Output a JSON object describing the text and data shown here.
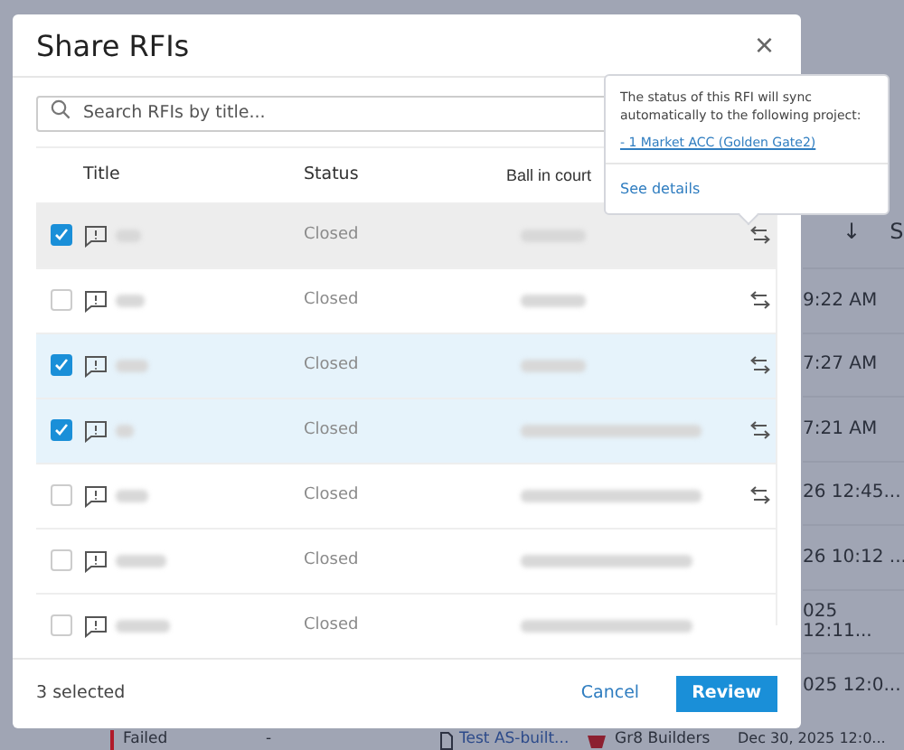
{
  "background": {
    "sort_arrow": "↓",
    "column_cut": "S",
    "times": [
      "9:22 AM",
      "7:27 AM",
      "7:21 AM",
      "26 12:45...",
      "26 10:12 ...",
      "025 12:11...",
      "025 12:0..."
    ],
    "last_row": {
      "status": "Failed",
      "dash": "-",
      "document": "Test AS-built...",
      "company": "Gr8 Builders",
      "date": "Dec 30, 2025 12:0..."
    }
  },
  "dialog": {
    "title": "Share RFIs",
    "close": "×",
    "search": {
      "placeholder": "Search RFIs by title..."
    },
    "columns": [
      "Title",
      "Status",
      "Ball in court"
    ],
    "rows": [
      {
        "checked": true,
        "hovered": true,
        "status": "Closed",
        "sync": true
      },
      {
        "checked": false,
        "hovered": false,
        "status": "Closed",
        "sync": true
      },
      {
        "checked": true,
        "hovered": false,
        "status": "Closed",
        "sync": true
      },
      {
        "checked": true,
        "hovered": false,
        "status": "Closed",
        "sync": true
      },
      {
        "checked": false,
        "hovered": false,
        "status": "Closed",
        "sync": true
      },
      {
        "checked": false,
        "hovered": false,
        "status": "Closed",
        "sync": false
      },
      {
        "checked": false,
        "hovered": false,
        "status": "Closed",
        "sync": false
      }
    ],
    "selected_count": "3 selected",
    "buttons": {
      "cancel": "Cancel",
      "review": "Review"
    }
  },
  "popover": {
    "message": "The status of this RFI will sync automatically to the following project:",
    "project_link": "- 1 Market ACC (Golden Gate2)",
    "details_link": "See details"
  }
}
